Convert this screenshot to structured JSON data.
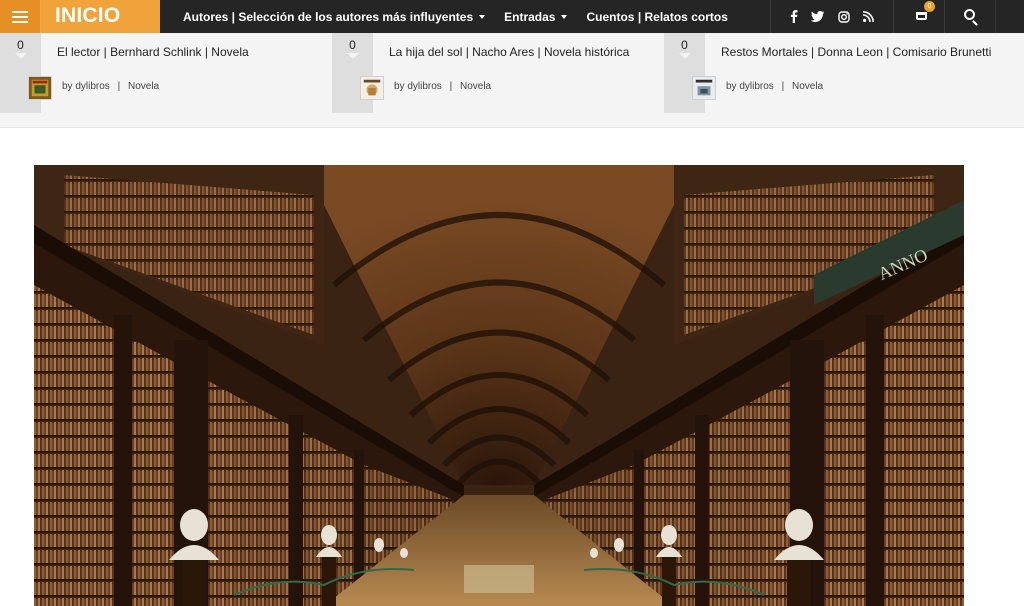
{
  "header": {
    "logo": "INICIO",
    "nav": [
      {
        "label": "Autores | Selección de los autores más influyentes",
        "dropdown": true
      },
      {
        "label": "Entradas",
        "dropdown": true
      },
      {
        "label": "Cuentos | Relatos cortos",
        "dropdown": false
      }
    ],
    "social_icons": [
      "facebook-icon",
      "twitter-icon",
      "instagram-icon",
      "rss-icon"
    ],
    "cart_count": "0",
    "accent_color": "#f0a33a"
  },
  "posts": [
    {
      "count": "0",
      "title": "El lector | Bernhard Schlink | Novela",
      "author_prefix": "by",
      "author": "dylibros",
      "category": "Novela"
    },
    {
      "count": "0",
      "title": "La hija del sol | Nacho Ares | Novela histórica",
      "author_prefix": "by",
      "author": "dylibros",
      "category": "Novela"
    },
    {
      "count": "0",
      "title": "Restos Mortales | Donna Leon | Comisario Brunetti",
      "author_prefix": "by",
      "author": "dylibros",
      "category": "Novela"
    }
  ],
  "hero": {
    "image_icon": "library-hall-photo",
    "inscription": "ANNO",
    "bust_icons": [
      "marble-bust-icon"
    ]
  }
}
